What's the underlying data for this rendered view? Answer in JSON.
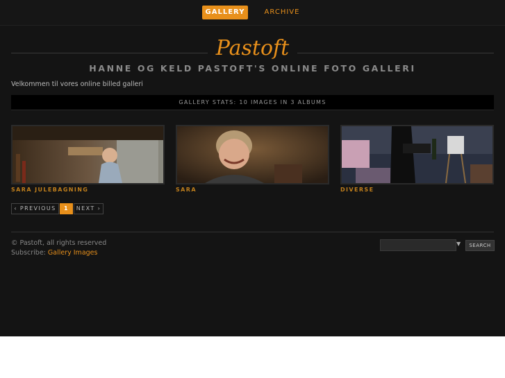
{
  "nav": {
    "gallery": "GALLERY",
    "archive": "ARCHIVE"
  },
  "site": {
    "title": "Pastoft",
    "subtitle": "HANNE OG KELD PASTOFT'S ONLINE FOTO GALLERI"
  },
  "welcome": "Velkommen til vores online billed galleri",
  "stats": "GALLERY STATS: 10 IMAGES IN 3 ALBUMS",
  "albums": [
    {
      "caption": "SARA JULEBAGNING"
    },
    {
      "caption": "SARA"
    },
    {
      "caption": "DIVERSE"
    }
  ],
  "pager": {
    "prev": "‹ PREVIOUS",
    "current": "1",
    "next": "NEXT ›"
  },
  "footer": {
    "copyright": "© Pastoft, all rights reserved",
    "subscribe_label": "Subscribe:",
    "subscribe_link": "Gallery Images",
    "search_button": "SEARCH"
  },
  "colors": {
    "accent": "#e8901b",
    "background": "#141414"
  }
}
